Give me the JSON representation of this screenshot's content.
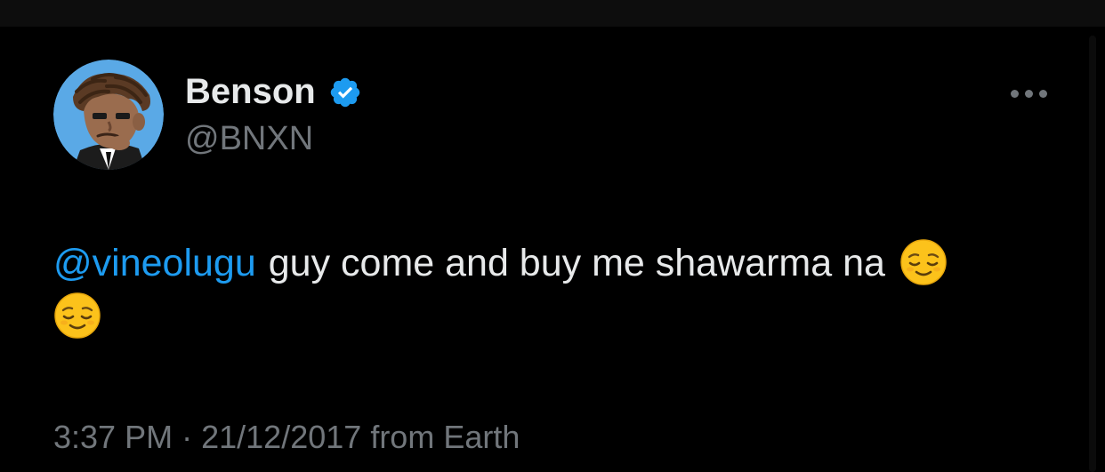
{
  "author": {
    "display_name": "Benson",
    "handle": "@BNXN",
    "verified": true,
    "avatar_icon": "cartoon-avatar-icon"
  },
  "tweet": {
    "mention": "@vineolugu",
    "text": "guy come and buy me shawarma na",
    "emoji": "relieved-face-emoji",
    "emoji_count": 2,
    "time": "3:37 PM",
    "separator": "·",
    "date": "21/12/2017",
    "source": "from Earth"
  },
  "colors": {
    "background": "#000000",
    "text": "#e7e9ea",
    "secondary": "#71767b",
    "accent": "#1d9bf0"
  }
}
